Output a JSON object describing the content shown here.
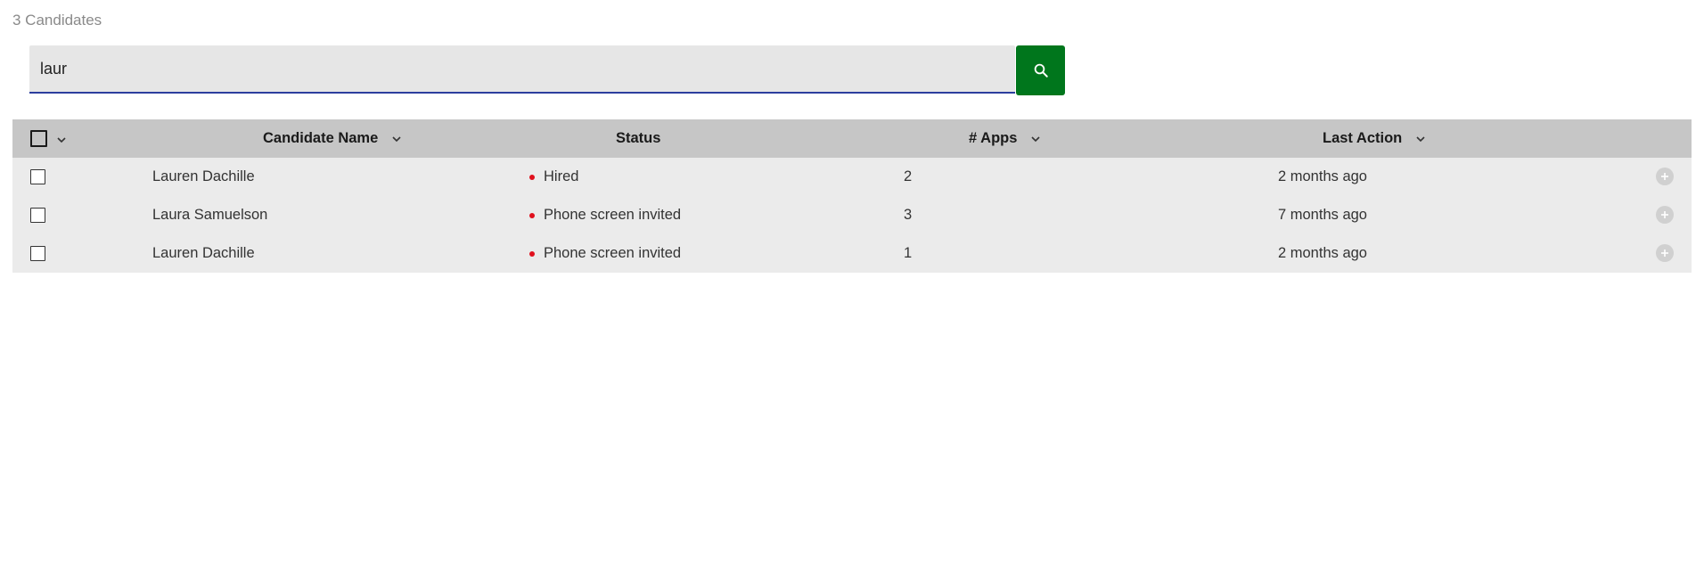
{
  "header": {
    "count_label": "3 Candidates"
  },
  "search": {
    "value": "laur",
    "icon": "search-icon",
    "button_color": "#00761c"
  },
  "table": {
    "columns": {
      "name": "Candidate Name",
      "status": "Status",
      "apps": "# Apps",
      "last_action": "Last Action"
    },
    "rows": [
      {
        "name": "Lauren Dachille",
        "status": "Hired",
        "apps": "2",
        "last_action": "2 months ago"
      },
      {
        "name": "Laura Samuelson",
        "status": "Phone screen invited",
        "apps": "3",
        "last_action": "7 months ago"
      },
      {
        "name": "Lauren Dachille",
        "status": "Phone screen invited",
        "apps": "1",
        "last_action": "2 months ago"
      }
    ],
    "colors": {
      "header_bg": "#c6c6c6",
      "row_bg": "#ebebeb",
      "status_dot": "#e0101d"
    }
  }
}
